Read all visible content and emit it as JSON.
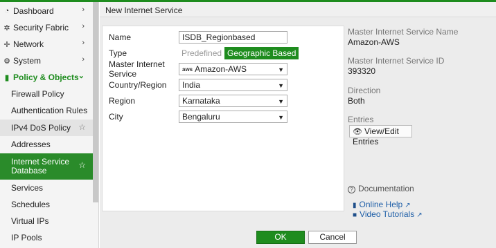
{
  "sidebar": {
    "items": [
      {
        "label": "Dashboard",
        "icon": "dashboard-icon",
        "glyph": "◔"
      },
      {
        "label": "Security Fabric",
        "icon": "fabric-icon",
        "glyph": "✲"
      },
      {
        "label": "Network",
        "icon": "network-icon",
        "glyph": "✛"
      },
      {
        "label": "System",
        "icon": "gear-icon",
        "glyph": "⚙"
      },
      {
        "label": "Policy & Objects",
        "icon": "policy-icon",
        "glyph": "▮"
      }
    ],
    "subitems": [
      {
        "label": "Firewall Policy"
      },
      {
        "label": "Authentication Rules"
      },
      {
        "label": "IPv4 DoS Policy"
      },
      {
        "label": "Addresses"
      },
      {
        "label": "Internet Service Database"
      },
      {
        "label": "Services"
      },
      {
        "label": "Schedules"
      },
      {
        "label": "Virtual IPs"
      },
      {
        "label": "IP Pools"
      }
    ]
  },
  "header": {
    "title": "New Internet Service"
  },
  "form": {
    "name_label": "Name",
    "name_value": "ISDB_Regionbased",
    "type_label": "Type",
    "type_options": [
      "Predefined",
      "Geographic Based"
    ],
    "master_label": "Master Internet Service",
    "master_value": "Amazon-AWS",
    "master_logo": "aws",
    "country_label": "Country/Region",
    "country_value": "India",
    "region_label": "Region",
    "region_value": "Karnataka",
    "city_label": "City",
    "city_value": "Bengaluru"
  },
  "info": {
    "master_name_label": "Master Internet Service Name",
    "master_name_value": "Amazon-AWS",
    "master_id_label": "Master Internet Service ID",
    "master_id_value": "393320",
    "direction_label": "Direction",
    "direction_value": "Both",
    "entries_label": "Entries",
    "view_edit_label": "View/Edit Entries",
    "documentation_label": "Documentation",
    "online_help_label": "Online Help",
    "video_tutorials_label": "Video Tutorials"
  },
  "buttons": {
    "ok": "OK",
    "cancel": "Cancel"
  },
  "colors": {
    "accent": "#1e8c1e",
    "link": "#1f5fa8"
  }
}
